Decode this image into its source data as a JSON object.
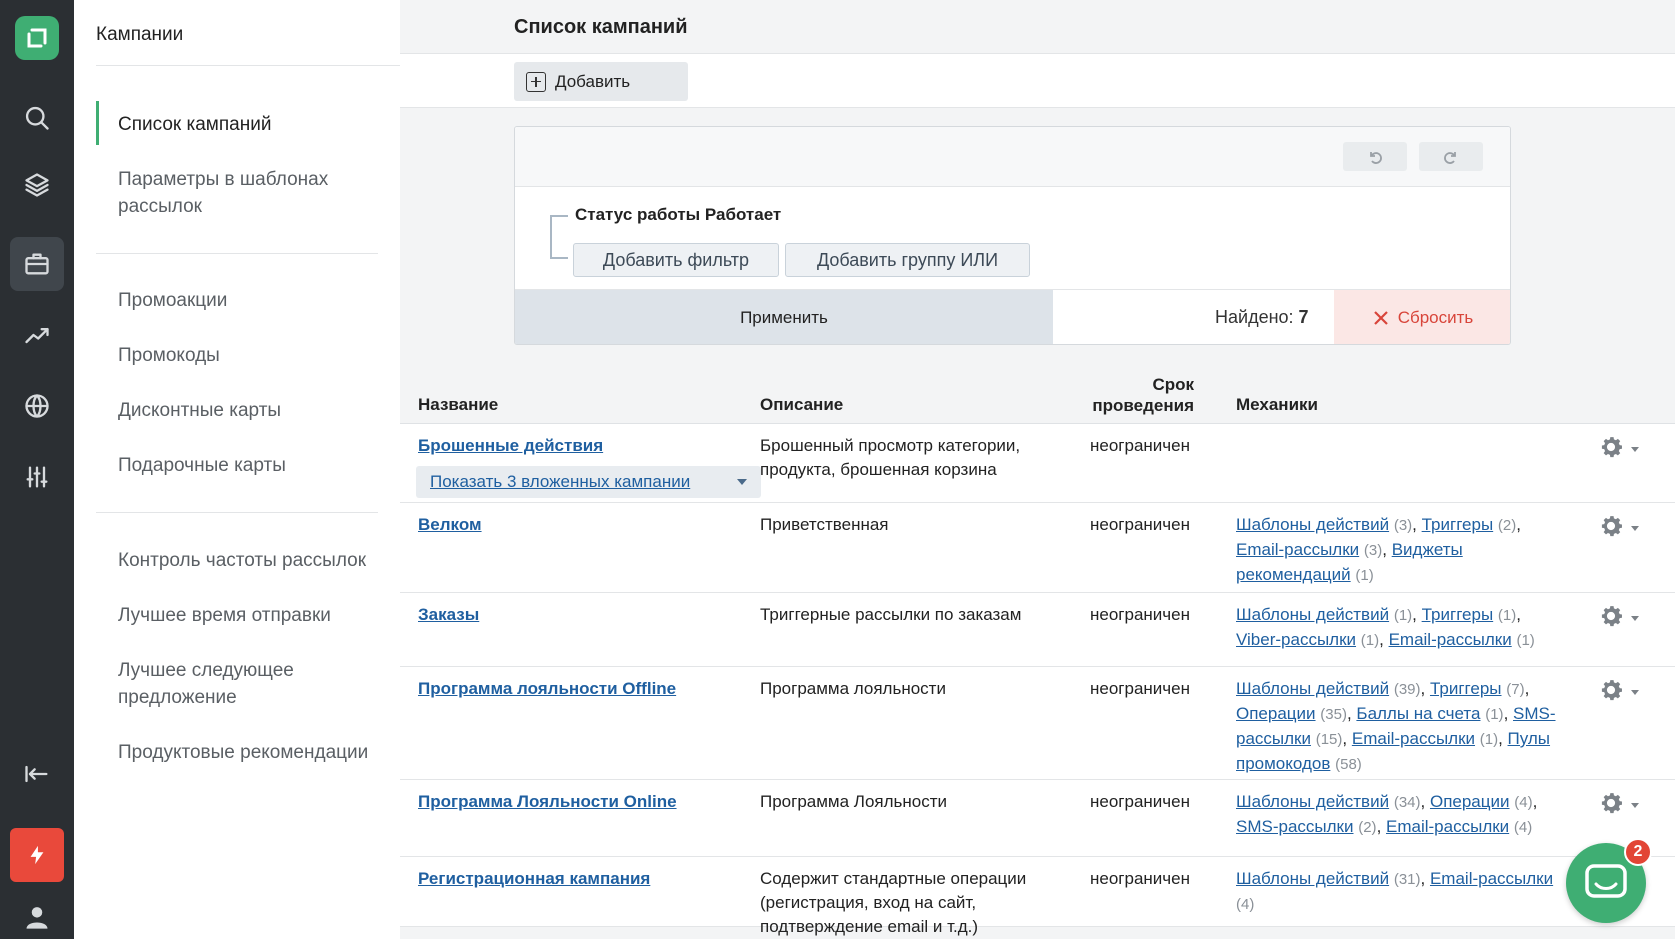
{
  "sidebar": {
    "title": "Кампании",
    "items": [
      {
        "label": "Список кампаний",
        "active": true
      },
      {
        "label": "Параметры в шаблонах рассылок"
      },
      {
        "label": "Промоакции"
      },
      {
        "label": "Промокоды"
      },
      {
        "label": "Дисконтные карты"
      },
      {
        "label": "Подарочные карты"
      },
      {
        "label": "Контроль частоты рассылок"
      },
      {
        "label": "Лучшее время отправки"
      },
      {
        "label": "Лучшее следующее предложение"
      },
      {
        "label": "Продуктовые рекомендации"
      }
    ]
  },
  "header": {
    "title": "Список кампаний"
  },
  "toolbar": {
    "add_label": "Добавить"
  },
  "filter": {
    "condition": "Статус работы Работает",
    "add_filter": "Добавить фильтр",
    "add_or_group": "Добавить группу ИЛИ",
    "apply": "Применить",
    "found_label": "Найдено:",
    "found_count": "7",
    "reset": "Сбросить"
  },
  "table": {
    "headers": {
      "name": "Название",
      "description": "Описание",
      "period": "Срок проведения",
      "mechanics": "Механики"
    },
    "rows": [
      {
        "name": "Брошенные действия",
        "description": "Брошенный просмотр категории, продукта, брошенная корзина",
        "period": "неограничен",
        "nested": "Показать 3 вложенных кампании",
        "mechanics": []
      },
      {
        "name": "Велком",
        "description": "Приветственная",
        "period": "неограничен",
        "mechanics": [
          {
            "label": "Шаблоны действий",
            "count": "(3)"
          },
          {
            "label": "Триггеры",
            "count": "(2)"
          },
          {
            "label": "Email-рассылки",
            "count": "(3)"
          },
          {
            "label": "Виджеты рекомендаций",
            "count": "(1)"
          }
        ]
      },
      {
        "name": "Заказы",
        "description": "Триггерные рассылки по заказам",
        "period": "неограничен",
        "mechanics": [
          {
            "label": "Шаблоны действий",
            "count": "(1)"
          },
          {
            "label": "Триггеры",
            "count": "(1)"
          },
          {
            "label": "Viber-рассылки",
            "count": "(1)"
          },
          {
            "label": "Email-рассылки",
            "count": "(1)"
          }
        ]
      },
      {
        "name": "Программа лояльности Offline",
        "description": "Программа лояльности",
        "period": "неограничен",
        "mechanics": [
          {
            "label": "Шаблоны действий",
            "count": "(39)"
          },
          {
            "label": "Триггеры",
            "count": "(7)"
          },
          {
            "label": "Операции",
            "count": "(35)"
          },
          {
            "label": "Баллы на счета",
            "count": "(1)"
          },
          {
            "label": "SMS-рассылки",
            "count": "(15)"
          },
          {
            "label": "Email-рассылки",
            "count": "(1)"
          },
          {
            "label": "Пулы промокодов",
            "count": "(58)"
          }
        ]
      },
      {
        "name": "Программа Лояльности Online",
        "description": "Программа Лояльности",
        "period": "неограничен",
        "mechanics": [
          {
            "label": "Шаблоны действий",
            "count": "(34)"
          },
          {
            "label": "Операции",
            "count": "(4)"
          },
          {
            "label": "SMS-рассылки",
            "count": "(2)"
          },
          {
            "label": "Email-рассылки",
            "count": "(4)"
          }
        ]
      },
      {
        "name": "Регистрационная кампания",
        "description": "Содержит стандартные операции (регистрация, вход на сайт, подтверждение email и т.д.)",
        "period": "неограничен",
        "mechanics": [
          {
            "label": "Шаблоны действий",
            "count": "(31)"
          },
          {
            "label": "Email-рассылки",
            "count": "(4)"
          }
        ]
      }
    ]
  },
  "chat": {
    "badge": "2"
  },
  "colors": {
    "accent": "#3fae73",
    "link": "#1f5fa0",
    "danger": "#d8453a",
    "rail": "#2b2f33"
  },
  "icons": [
    "logo-icon",
    "search-icon",
    "layers-icon",
    "briefcase-icon",
    "trend-icon",
    "globe-icon",
    "sliders-icon",
    "collapse-icon",
    "flash-icon",
    "user-icon",
    "undo-icon",
    "redo-icon",
    "gear-icon",
    "chat-icon"
  ]
}
